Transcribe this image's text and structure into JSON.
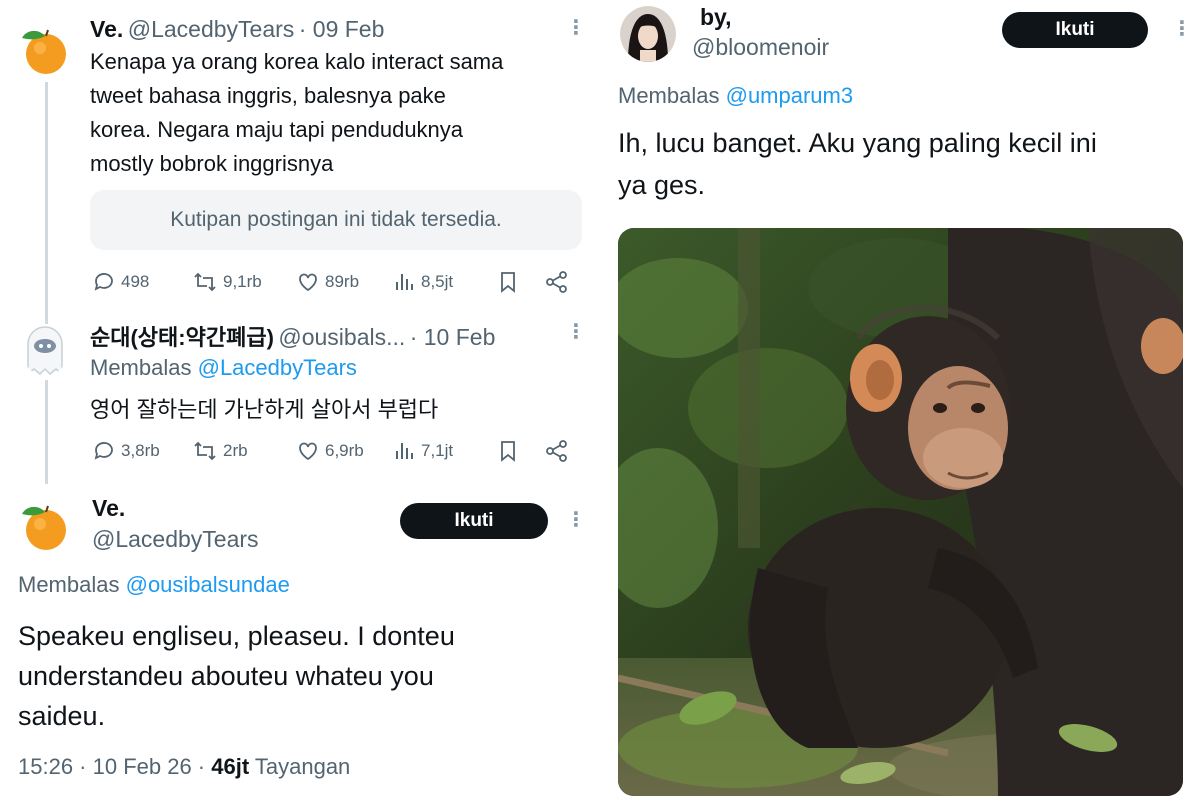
{
  "left": {
    "tweet1": {
      "name": "Ve.",
      "handle": "@LacedbyTears",
      "date": "· 09 Feb",
      "text_lines": [
        "Kenapa ya orang korea kalo interact sama",
        "tweet bahasa inggris, balesnya pake",
        "korea. Negara maju tapi penduduknya",
        "mostly bobrok inggrisnya"
      ],
      "quote": "Kutipan postingan ini tidak tersedia.",
      "stats": {
        "replies": "498",
        "reposts": "9,1rb",
        "likes": "89rb",
        "views": "8,5jt"
      }
    },
    "tweet2": {
      "name": "순대(상태:약간폐급)",
      "handle": "@ousibals...",
      "date": "· 10 Feb",
      "reply_prefix": "Membalas",
      "reply_to": "@LacedbyTears",
      "text": "영어 잘하는데 가난하게 살아서 부럽다",
      "stats": {
        "replies": "3,8rb",
        "reposts": "2rb",
        "likes": "6,9rb",
        "views": "7,1jt"
      }
    },
    "tweet3": {
      "name": "Ve.",
      "handle": "@LacedbyTears",
      "follow": "Ikuti",
      "reply_prefix": "Membalas",
      "reply_to": "@ousibalsundae",
      "text_lines": [
        "Speakeu engliseu, pleaseu. I donteu",
        "understandeu abouteu whateu you",
        "saideu."
      ],
      "timestamp": "15:26 · 10 Feb 26 · ",
      "views_count": "46jt",
      "views_label": " Tayangan"
    }
  },
  "right": {
    "tweet": {
      "name": "by,",
      "handle": "@bloomenoir",
      "follow": "Ikuti",
      "reply_prefix": "Membalas",
      "reply_to": "@umparum3",
      "text_lines": [
        "Ih, lucu banget. Aku yang paling kecil ini",
        "ya ges."
      ],
      "image_icon": "chimpanzee-photo"
    }
  },
  "colors": {
    "text": "#0f1419",
    "muted": "#536471",
    "link": "#1d9bf0",
    "follow_bg": "#0f1419",
    "quote_bg": "#f2f4f5"
  }
}
